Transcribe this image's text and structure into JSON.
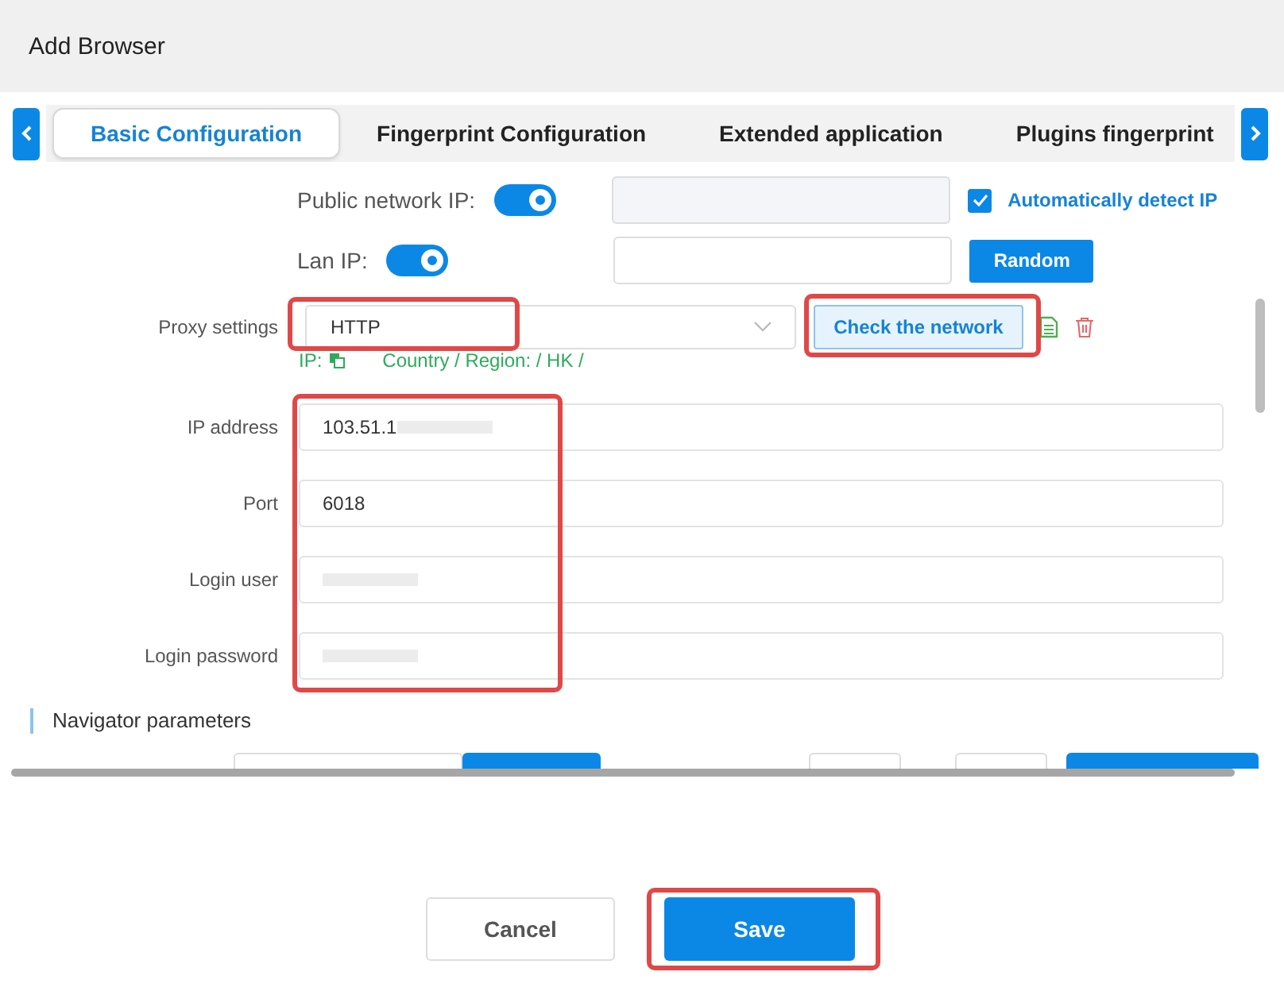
{
  "window": {
    "title": "Add Browser"
  },
  "tabs": [
    {
      "label": "Basic Configuration",
      "selected": true
    },
    {
      "label": "Fingerprint Configuration",
      "selected": false
    },
    {
      "label": "Extended application",
      "selected": false
    },
    {
      "label": "Plugins fingerprint",
      "selected": false
    }
  ],
  "public_ip": {
    "label": "Public network IP:",
    "on": true,
    "disabled": true,
    "auto_detect": {
      "label": "Automatically detect IP",
      "checked": true
    }
  },
  "lan_ip": {
    "label": "Lan IP:",
    "on": true,
    "button": "Random"
  },
  "proxy": {
    "label": "Proxy settings",
    "value": "HTTP",
    "highlighted": true,
    "check_button": "Check the network",
    "check_highlighted": true,
    "ip_label": "IP:",
    "region": "Country / Region: / HK /"
  },
  "fields": [
    {
      "label": "IP address",
      "value": "103.51.1",
      "redacted": true
    },
    {
      "label": "Port",
      "value": "6018",
      "redacted": false
    },
    {
      "label": "Login user",
      "redacted": true
    },
    {
      "label": "Login password",
      "redacted": true
    }
  ],
  "fields_highlighted": true,
  "section": {
    "title": "Navigator parameters"
  },
  "footer": {
    "cancel": "Cancel",
    "save": "Save",
    "save_highlighted": true
  }
}
